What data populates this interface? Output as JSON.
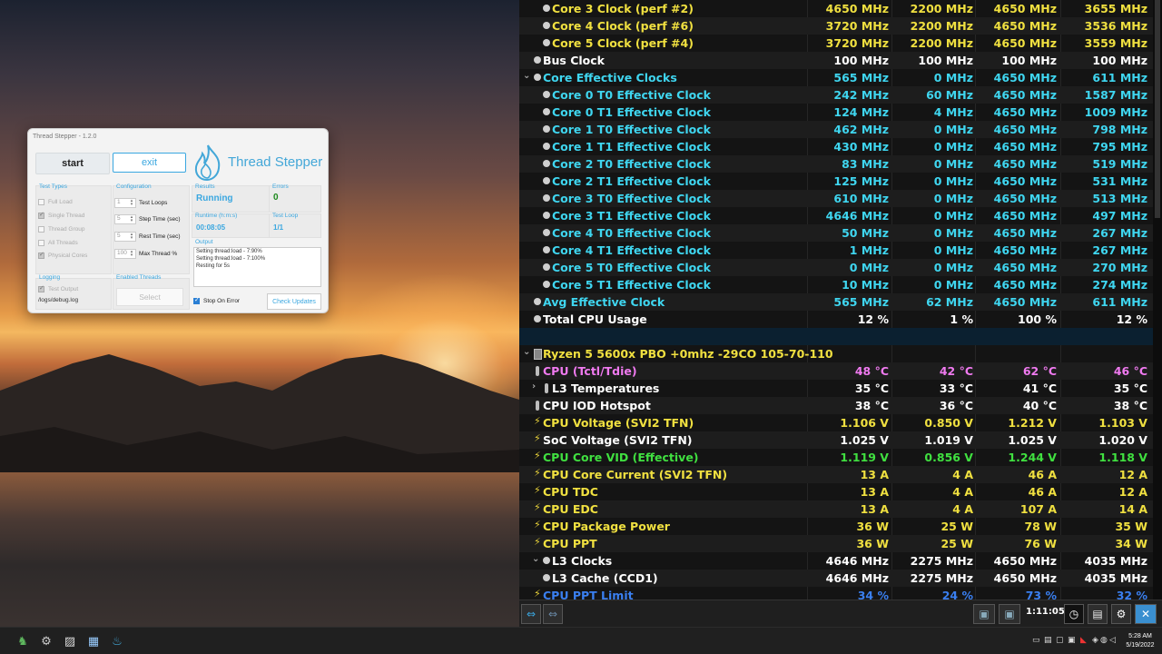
{
  "thread_stepper": {
    "title": "Thread Stepper - 1.2.0",
    "start_label": "start",
    "exit_label": "exit",
    "logo_text": "Thread Stepper",
    "test_types": {
      "label": "Test Types",
      "items": [
        {
          "label": "Full Load",
          "checked": false
        },
        {
          "label": "Single Thread",
          "checked": true
        },
        {
          "label": "Thread Group",
          "checked": false
        },
        {
          "label": "All Threads",
          "checked": false
        },
        {
          "label": "Physical Cores",
          "checked": true
        }
      ]
    },
    "configuration": {
      "label": "Configuration",
      "fields": [
        {
          "value": "1",
          "label": "Test Loops"
        },
        {
          "value": "5",
          "label": "Step Time (sec)"
        },
        {
          "value": "5",
          "label": "Rest Time (sec)"
        },
        {
          "value": "100",
          "label": "Max Thread %"
        }
      ]
    },
    "results": {
      "label": "Results",
      "value": "Running"
    },
    "errors": {
      "label": "Errors",
      "value": "0"
    },
    "runtime": {
      "label": "Runtime (h:m:s)",
      "value": "00:08:05"
    },
    "test_loop": {
      "label": "Test Loop",
      "value": "1/1"
    },
    "output": {
      "label": "Output",
      "lines": [
        "Setting thread:load - 7:90%",
        "Setting thread:load - 7:100%",
        "Resting for 5s"
      ]
    },
    "logging": {
      "label": "Logging",
      "test_output_label": "Test Output",
      "log_path": "/logs/debug.log"
    },
    "enabled_threads": {
      "label": "Enabled Threads",
      "select_label": "Select"
    },
    "stop_on_error_label": "Stop On Error",
    "check_updates_label": "Check Updates"
  },
  "sensors": {
    "rows": [
      {
        "name": "Core 3 Clock (perf #2)",
        "values": [
          "4650 MHz",
          "2200 MHz",
          "4650 MHz",
          "3655 MHz"
        ],
        "color": "#f0e040",
        "indent": 2,
        "icon": "dot"
      },
      {
        "name": "Core 4 Clock (perf #6)",
        "values": [
          "3720 MHz",
          "2200 MHz",
          "4650 MHz",
          "3536 MHz"
        ],
        "color": "#f0e040",
        "indent": 2,
        "icon": "dot"
      },
      {
        "name": "Core 5 Clock (perf #4)",
        "values": [
          "3720 MHz",
          "2200 MHz",
          "4650 MHz",
          "3559 MHz"
        ],
        "color": "#f0e040",
        "indent": 2,
        "icon": "dot"
      },
      {
        "name": "Bus Clock",
        "values": [
          "100 MHz",
          "100 MHz",
          "100 MHz",
          "100 MHz"
        ],
        "color": "#ffffff",
        "indent": 1,
        "icon": "dot"
      },
      {
        "name": "Core Effective Clocks",
        "values": [
          "565 MHz",
          "0 MHz",
          "4650 MHz",
          "611 MHz"
        ],
        "color": "#3fd6f0",
        "indent": 1,
        "icon": "dot",
        "expander": "⌄"
      },
      {
        "name": "Core 0 T0 Effective Clock",
        "values": [
          "242 MHz",
          "60 MHz",
          "4650 MHz",
          "1587 MHz"
        ],
        "color": "#3fd6f0",
        "indent": 2,
        "icon": "dot"
      },
      {
        "name": "Core 0 T1 Effective Clock",
        "values": [
          "124 MHz",
          "4 MHz",
          "4650 MHz",
          "1009 MHz"
        ],
        "color": "#3fd6f0",
        "indent": 2,
        "icon": "dot"
      },
      {
        "name": "Core 1 T0 Effective Clock",
        "values": [
          "462 MHz",
          "0 MHz",
          "4650 MHz",
          "798 MHz"
        ],
        "color": "#3fd6f0",
        "indent": 2,
        "icon": "dot"
      },
      {
        "name": "Core 1 T1 Effective Clock",
        "values": [
          "430 MHz",
          "0 MHz",
          "4650 MHz",
          "795 MHz"
        ],
        "color": "#3fd6f0",
        "indent": 2,
        "icon": "dot"
      },
      {
        "name": "Core 2 T0 Effective Clock",
        "values": [
          "83 MHz",
          "0 MHz",
          "4650 MHz",
          "519 MHz"
        ],
        "color": "#3fd6f0",
        "indent": 2,
        "icon": "dot"
      },
      {
        "name": "Core 2 T1 Effective Clock",
        "values": [
          "125 MHz",
          "0 MHz",
          "4650 MHz",
          "531 MHz"
        ],
        "color": "#3fd6f0",
        "indent": 2,
        "icon": "dot"
      },
      {
        "name": "Core 3 T0 Effective Clock",
        "values": [
          "610 MHz",
          "0 MHz",
          "4650 MHz",
          "513 MHz"
        ],
        "color": "#3fd6f0",
        "indent": 2,
        "icon": "dot"
      },
      {
        "name": "Core 3 T1 Effective Clock",
        "values": [
          "4646 MHz",
          "0 MHz",
          "4650 MHz",
          "497 MHz"
        ],
        "color": "#3fd6f0",
        "indent": 2,
        "icon": "dot"
      },
      {
        "name": "Core 4 T0 Effective Clock",
        "values": [
          "50 MHz",
          "0 MHz",
          "4650 MHz",
          "267 MHz"
        ],
        "color": "#3fd6f0",
        "indent": 2,
        "icon": "dot"
      },
      {
        "name": "Core 4 T1 Effective Clock",
        "values": [
          "1 MHz",
          "0 MHz",
          "4650 MHz",
          "267 MHz"
        ],
        "color": "#3fd6f0",
        "indent": 2,
        "icon": "dot"
      },
      {
        "name": "Core 5 T0 Effective Clock",
        "values": [
          "0 MHz",
          "0 MHz",
          "4650 MHz",
          "270 MHz"
        ],
        "color": "#3fd6f0",
        "indent": 2,
        "icon": "dot"
      },
      {
        "name": "Core 5 T1 Effective Clock",
        "values": [
          "10 MHz",
          "0 MHz",
          "4650 MHz",
          "274 MHz"
        ],
        "color": "#3fd6f0",
        "indent": 2,
        "icon": "dot"
      },
      {
        "name": "Avg Effective Clock",
        "values": [
          "565 MHz",
          "62 MHz",
          "4650 MHz",
          "611 MHz"
        ],
        "color": "#3fd6f0",
        "indent": 1,
        "icon": "dot"
      },
      {
        "name": "Total CPU Usage",
        "values": [
          "12 %",
          "1 %",
          "100 %",
          "12 %"
        ],
        "color": "#ffffff",
        "indent": 1,
        "icon": "dot"
      },
      {
        "name": "",
        "values": [
          "",
          "",
          "",
          ""
        ],
        "color": "#ffffff",
        "indent": 0,
        "icon": "none",
        "band": true
      },
      {
        "name": "Ryzen 5 5600x PBO +0mhz -29CO 105-70-110",
        "values": [
          "",
          "",
          "",
          ""
        ],
        "color": "#f0e040",
        "indent": 1,
        "icon": "chip",
        "expander": "⌄"
      },
      {
        "name": "CPU (Tctl/Tdie)",
        "values": [
          "48 °C",
          "42 °C",
          "62 °C",
          "46 °C"
        ],
        "color": "#f07af0",
        "indent": 1,
        "icon": "therm"
      },
      {
        "name": "L3 Temperatures",
        "values": [
          "35 °C",
          "33 °C",
          "41 °C",
          "35 °C"
        ],
        "color": "#ffffff",
        "indent": 2,
        "icon": "therm",
        "expander": "›"
      },
      {
        "name": "CPU IOD Hotspot",
        "values": [
          "38 °C",
          "36 °C",
          "40 °C",
          "38 °C"
        ],
        "color": "#ffffff",
        "indent": 1,
        "icon": "therm"
      },
      {
        "name": "CPU Voltage (SVI2 TFN)",
        "values": [
          "1.106 V",
          "0.850 V",
          "1.212 V",
          "1.103 V"
        ],
        "color": "#f0e040",
        "indent": 1,
        "icon": "bolt"
      },
      {
        "name": "SoC Voltage (SVI2 TFN)",
        "values": [
          "1.025 V",
          "1.019 V",
          "1.025 V",
          "1.020 V"
        ],
        "color": "#ffffff",
        "indent": 1,
        "icon": "bolt"
      },
      {
        "name": "CPU Core VID (Effective)",
        "values": [
          "1.119 V",
          "0.856 V",
          "1.244 V",
          "1.118 V"
        ],
        "color": "#40e040",
        "indent": 1,
        "icon": "bolt"
      },
      {
        "name": "CPU Core Current (SVI2 TFN)",
        "values": [
          "13 A",
          "4 A",
          "46 A",
          "12 A"
        ],
        "color": "#f0e040",
        "indent": 1,
        "icon": "bolt"
      },
      {
        "name": "CPU TDC",
        "values": [
          "13 A",
          "4 A",
          "46 A",
          "12 A"
        ],
        "color": "#f0e040",
        "indent": 1,
        "icon": "bolt"
      },
      {
        "name": "CPU EDC",
        "values": [
          "13 A",
          "4 A",
          "107 A",
          "14 A"
        ],
        "color": "#f0e040",
        "indent": 1,
        "icon": "bolt"
      },
      {
        "name": "CPU Package Power",
        "values": [
          "36 W",
          "25 W",
          "78 W",
          "35 W"
        ],
        "color": "#f0e040",
        "indent": 1,
        "icon": "bolt"
      },
      {
        "name": "CPU PPT",
        "values": [
          "36 W",
          "25 W",
          "76 W",
          "34 W"
        ],
        "color": "#f0e040",
        "indent": 1,
        "icon": "bolt"
      },
      {
        "name": "L3 Clocks",
        "values": [
          "4646 MHz",
          "2275 MHz",
          "4650 MHz",
          "4035 MHz"
        ],
        "color": "#ffffff",
        "indent": 2,
        "icon": "dot",
        "expander": "⌄"
      },
      {
        "name": "L3 Cache (CCD1)",
        "values": [
          "4646 MHz",
          "2275 MHz",
          "4650 MHz",
          "4035 MHz"
        ],
        "color": "#ffffff",
        "indent": 2,
        "icon": "dot"
      },
      {
        "name": "CPU PPT Limit",
        "values": [
          "34 %",
          "24 %",
          "73 %",
          "32 %"
        ],
        "color": "#3a7ff0",
        "indent": 1,
        "icon": "bolt"
      }
    ]
  },
  "hw_toolbar": {
    "timer": "1:11:05",
    "left_icons": [
      "nav-arrows-icon",
      "nav-collapse-icon"
    ],
    "right_icons": [
      "network-icon",
      "network-compare-icon",
      "clock-icon",
      "report-icon",
      "settings-icon",
      "close-icon"
    ]
  },
  "taskbar": {
    "clock_time": "5:28 AM",
    "clock_date": "5/19/2022",
    "apps": [
      "game-icon",
      "steam-icon",
      "folder-icon",
      "hwinfo-icon",
      "flame-icon"
    ]
  }
}
